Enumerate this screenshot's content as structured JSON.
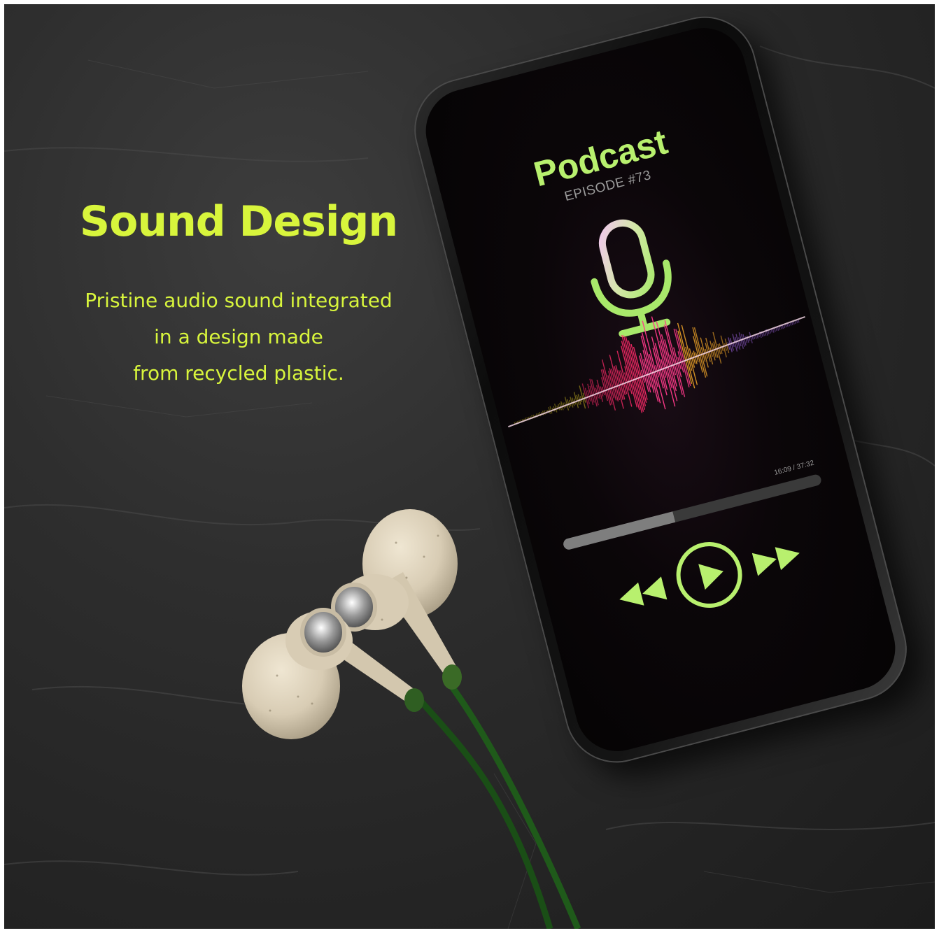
{
  "ad": {
    "headline": "Sound Design",
    "body_lines": [
      "Pristine audio sound integrated",
      "in a design made",
      "from recycled plastic."
    ]
  },
  "player": {
    "title": "Podcast",
    "episode": "EPISODE #73",
    "time": "16:09 / 37:32",
    "progress_fraction": 0.43,
    "icons": [
      "microphone-icon",
      "rewind-icon",
      "play-icon",
      "fast-forward-icon"
    ]
  },
  "colors": {
    "accent": "#d8f53c",
    "player_green": "#b8f06e",
    "earphone_cable": "#1f5a1a",
    "earphone_shell": "#d8ccb4",
    "background": "#2a2a2a"
  }
}
